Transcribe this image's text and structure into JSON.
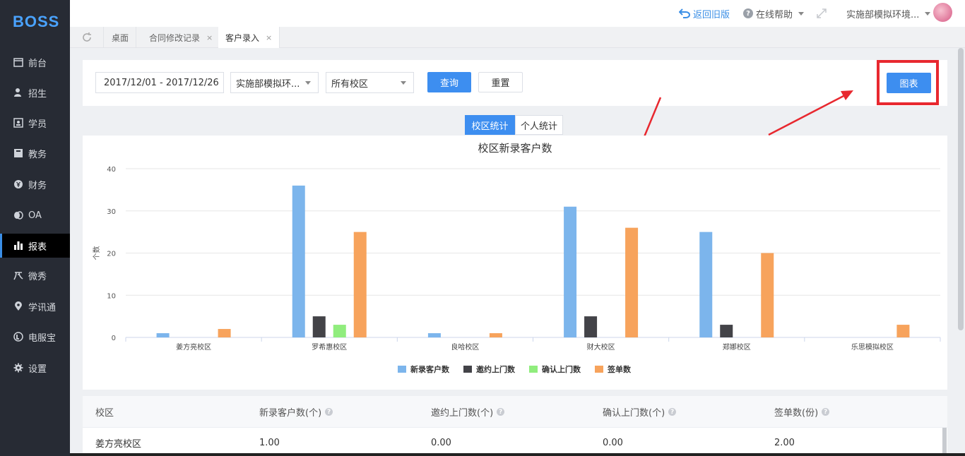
{
  "app": {
    "logo": "BOSS"
  },
  "sidebar": {
    "items": [
      {
        "label": "前台",
        "icon": "calendar-icon"
      },
      {
        "label": "招生",
        "icon": "user-add-icon"
      },
      {
        "label": "学员",
        "icon": "id-card-icon"
      },
      {
        "label": "教务",
        "icon": "book-icon"
      },
      {
        "label": "财务",
        "icon": "yen-icon"
      },
      {
        "label": "OA",
        "icon": "chat-icon"
      },
      {
        "label": "报表",
        "icon": "bar-chart-icon",
        "active": true
      },
      {
        "label": "微秀",
        "icon": "sparkle-icon"
      },
      {
        "label": "学讯通",
        "icon": "location-icon"
      },
      {
        "label": "电服宝",
        "icon": "phone-icon"
      },
      {
        "label": "设置",
        "icon": "gear-icon"
      }
    ]
  },
  "topbar": {
    "back_label": "返回旧版",
    "help_label": "在线帮助",
    "org_label": "实施部模拟环境..."
  },
  "tabs": [
    {
      "label": "桌面",
      "closable": false
    },
    {
      "label": "合同修改记录",
      "closable": true
    },
    {
      "label": "客户录入",
      "closable": true,
      "active": true
    }
  ],
  "tab_close_glyph": "×",
  "filters": {
    "date_range": "2017/12/01 - 2017/12/26",
    "org_select": "实施部模拟环...",
    "campus_select": "所有校区",
    "query_label": "查询",
    "reset_label": "重置",
    "chart_label": "图表"
  },
  "segment": {
    "campus_label": "校区统计",
    "personal_label": "个人统计"
  },
  "colors": {
    "accent": "#3d8ef0",
    "sidebar_bg": "#272b34",
    "highlight": "#e8282f"
  },
  "chart_data": {
    "type": "bar",
    "title": "校区新录客户数",
    "ylabel": "个数",
    "xlabel": "",
    "ylim": [
      0,
      40
    ],
    "yticks": [
      0,
      10,
      20,
      30,
      40
    ],
    "grid": true,
    "legend_position": "bottom",
    "categories": [
      "姜方亮校区",
      "罗希惠校区",
      "良哈校区",
      "财大校区",
      "郑娜校区",
      "乐思模拟校区"
    ],
    "series": [
      {
        "name": "新录客户数",
        "color": "#7cb5ec",
        "values": [
          1,
          36,
          1,
          31,
          25,
          0
        ]
      },
      {
        "name": "邀约上门数",
        "color": "#434348",
        "values": [
          0,
          5,
          0,
          5,
          3,
          0
        ]
      },
      {
        "name": "确认上门数",
        "color": "#90ed7d",
        "values": [
          0,
          3,
          0,
          0,
          0,
          0
        ]
      },
      {
        "name": "签单数",
        "color": "#f7a35c",
        "values": [
          2,
          25,
          1,
          26,
          20,
          3
        ]
      }
    ]
  },
  "table": {
    "headers": [
      "校区",
      "新录客户数(个)",
      "邀约上门数(个)",
      "确认上门数(个)",
      "签单数(份)"
    ],
    "help_glyph": "?",
    "rows": [
      [
        "姜方亮校区",
        "1.00",
        "0.00",
        "0.00",
        "2.00"
      ]
    ]
  }
}
